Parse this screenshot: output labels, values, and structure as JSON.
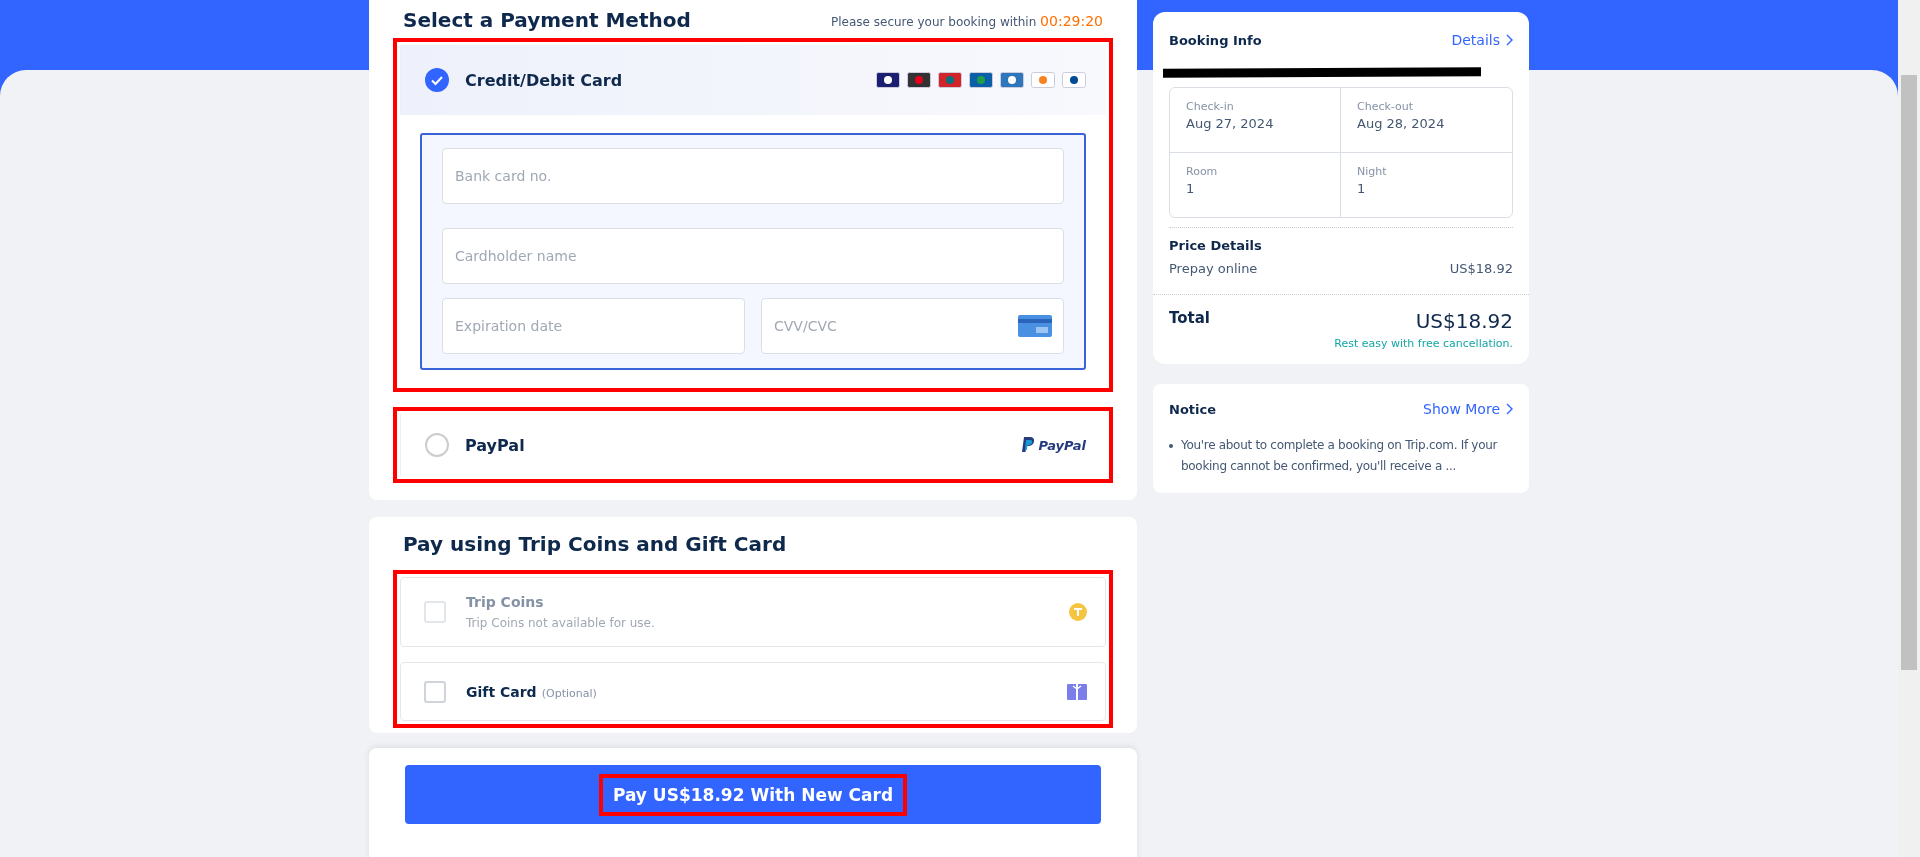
{
  "payment": {
    "title": "Select a Payment Method",
    "timer_label": "Please secure your booking within",
    "timer": "00:29:20",
    "methods": [
      {
        "kind": "card",
        "label": "Credit/Debit Card",
        "selected": true,
        "highlighted": true,
        "fields": [
          {
            "placeholder": "Bank card no."
          },
          {
            "placeholder": "Cardholder name"
          },
          {
            "placeholder": "Expiration date"
          },
          {
            "placeholder": "CVV/CVC"
          }
        ]
      },
      {
        "kind": "paypal",
        "label": "PayPal",
        "selected": false,
        "highlighted": true,
        "logo_text": "PayPal"
      }
    ]
  },
  "extras": {
    "title": "Pay using Trip Coins and Gift Card",
    "highlighted": true,
    "items": [
      {
        "kind": "coins",
        "label": "Trip Coins",
        "note": "Trip Coins not available for use.",
        "checked": false,
        "disabled": true
      },
      {
        "kind": "gift",
        "label": "Gift Card",
        "note": "(Optional)",
        "checked": false,
        "disabled": false
      }
    ]
  },
  "pay_button": {
    "label": "Pay US$18.92 With New Card",
    "highlighted": true
  },
  "booking": {
    "title": "Booking Info",
    "details_link": "Details",
    "info": [
      {
        "label": "Check-in",
        "value": "Aug 27, 2024"
      },
      {
        "label": "Check-out",
        "value": "Aug 28, 2024"
      },
      {
        "label": "Room",
        "value": "1"
      },
      {
        "label": "Night",
        "value": "1"
      }
    ],
    "price_title": "Price Details",
    "price_rows": [
      {
        "label": "Prepay online",
        "value": "US$18.92"
      }
    ],
    "total_label": "Total",
    "total": "US$18.92",
    "cancellation": "Rest easy with free cancellation."
  },
  "notice": {
    "title": "Notice",
    "link": "Show More",
    "items": [
      "You're about to complete a booking on Trip.com. If your booking cannot be confirmed, you'll receive a ..."
    ]
  }
}
